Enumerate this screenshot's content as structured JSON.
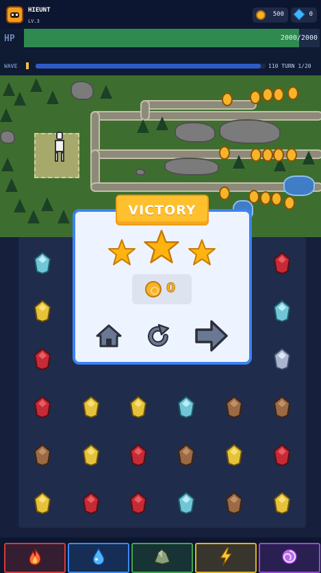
{
  "player": {
    "name": "HIEUNT",
    "level": "LV.3"
  },
  "currency": {
    "coins": "500",
    "gems": "0"
  },
  "hp": {
    "label": "HP",
    "text": "2000/2000",
    "fraction": 0.93
  },
  "wave": {
    "label": "WAVE",
    "text": "110 TURN 1/20",
    "fraction": 0.98
  },
  "victory": {
    "title": "VICTORY",
    "stars_earned": 3,
    "stars_total": 3,
    "reward_coins": "0",
    "buttons": [
      "home-icon",
      "retry-icon",
      "next-arrow-icon"
    ]
  },
  "board": {
    "rows": [
      [
        "ice",
        "",
        "",
        "",
        "",
        "ruby"
      ],
      [
        "topaz",
        "",
        "",
        "",
        "",
        "ice"
      ],
      [
        "ruby",
        "",
        "",
        "",
        "",
        "silver"
      ],
      [
        "ruby",
        "topaz",
        "topaz",
        "ice",
        "earth",
        "earth"
      ],
      [
        "earth",
        "topaz",
        "ruby",
        "earth",
        "topaz",
        "ruby"
      ],
      [
        "topaz",
        "ruby",
        "ruby",
        "ice",
        "earth",
        "topaz"
      ]
    ]
  },
  "skills": [
    {
      "name": "fire",
      "icon": "flame-icon",
      "color": "#d93a3a"
    },
    {
      "name": "water",
      "icon": "water-drop-icon",
      "color": "#3b8cf0"
    },
    {
      "name": "earth",
      "icon": "rock-icon",
      "color": "#3faa4a"
    },
    {
      "name": "lightning",
      "icon": "lightning-icon",
      "color": "#e5b220"
    },
    {
      "name": "arcane",
      "icon": "vortex-icon",
      "color": "#9b4ad9"
    }
  ],
  "colors": {
    "accent": "#3b82f6",
    "banner": "#ffc02e",
    "hp": "#2f8a4f",
    "wave": "#2f5bc7",
    "star": "#ffb30f"
  }
}
